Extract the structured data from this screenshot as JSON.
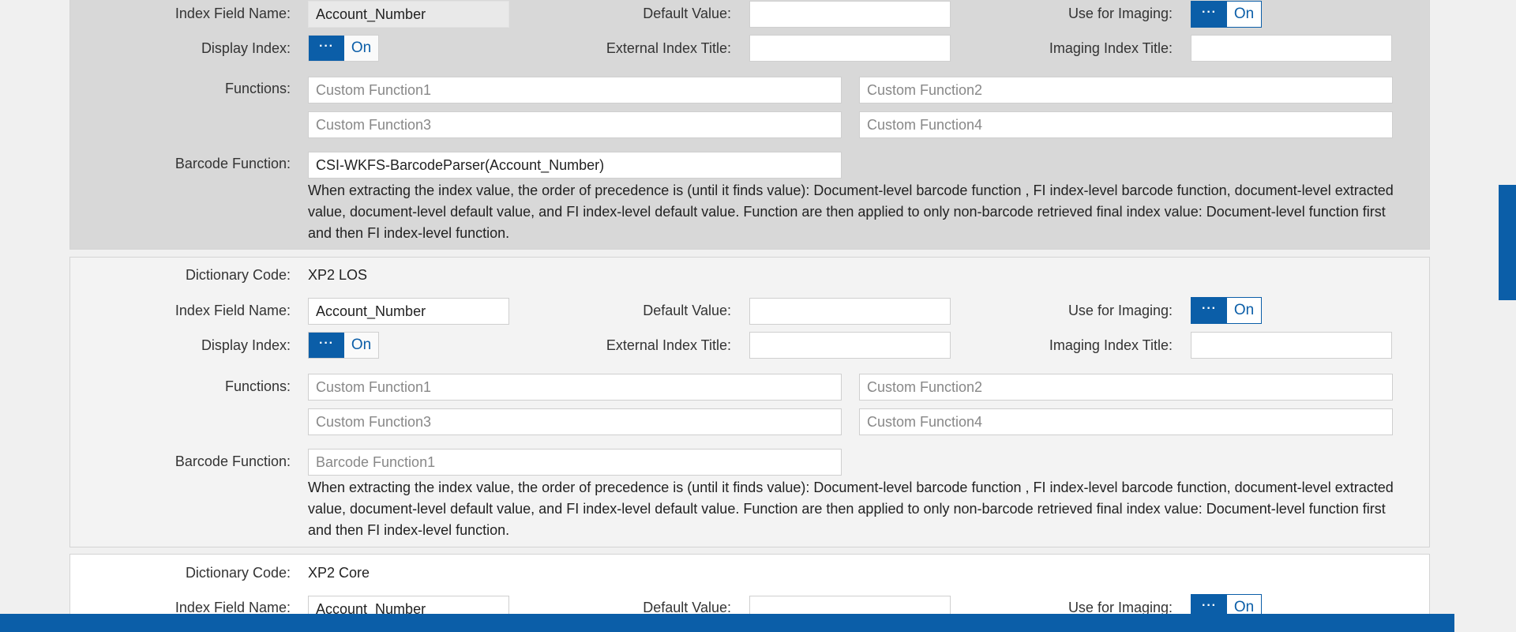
{
  "labels": {
    "dictionary_code": "Dictionary Code:",
    "index_field_name": "Index Field Name:",
    "default_value": "Default Value:",
    "use_for_imaging": "Use for Imaging:",
    "display_index": "Display Index:",
    "external_index_title": "External Index Title:",
    "imaging_index_title": "Imaging Index Title:",
    "functions": "Functions:",
    "barcode_function": "Barcode Function:"
  },
  "toggle": {
    "knob": "···",
    "state": "On"
  },
  "precedence_note": "When extracting the index value, the order of precedence is (until it finds value): Document-level barcode function , FI index-level barcode function, document-level extracted value, document-level default value, and FI index-level default value. Function are then applied to only non-barcode retrieved final index value: Document-level function first and then FI index-level function.",
  "sections": [
    {
      "index_field_name": "Account_Number",
      "default_value": "",
      "external_index_title": "",
      "imaging_index_title": "",
      "use_for_imaging": "On",
      "display_index": "On",
      "functions_placeholders": [
        "Custom Function1",
        "Custom Function2",
        "Custom Function3",
        "Custom Function4"
      ],
      "barcode_function": "CSI-WKFS-BarcodeParser(Account_Number)"
    },
    {
      "dictionary_code": "XP2 LOS",
      "index_field_name": "Account_Number",
      "default_value": "",
      "external_index_title": "",
      "imaging_index_title": "",
      "use_for_imaging": "On",
      "display_index": "On",
      "functions_placeholders": [
        "Custom Function1",
        "Custom Function2",
        "Custom Function3",
        "Custom Function4"
      ],
      "barcode_function_placeholder": "Barcode Function1"
    },
    {
      "dictionary_code": "XP2 Core",
      "index_field_name": "Account_Number",
      "default_value": "",
      "use_for_imaging": "On"
    }
  ],
  "colors": {
    "accent": "#0b5ea8",
    "panel_selected": "#d8d8d8",
    "panel_default": "#f3f3f3",
    "page_bg": "#f0f0f0"
  }
}
